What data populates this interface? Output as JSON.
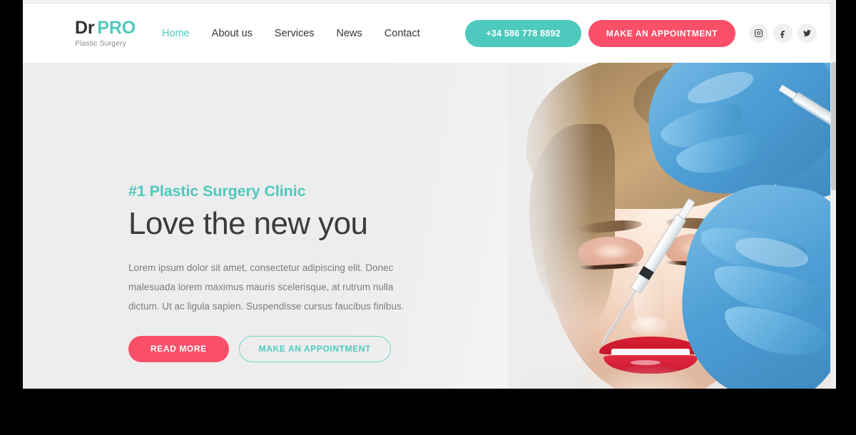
{
  "header": {
    "logo": {
      "main_dark": "Dr",
      "main_accent": "PRO",
      "tagline": "Plastic Surgery"
    },
    "nav": [
      {
        "label": "Home",
        "active": true
      },
      {
        "label": "About us",
        "active": false
      },
      {
        "label": "Services",
        "active": false
      },
      {
        "label": "News",
        "active": false
      },
      {
        "label": "Contact",
        "active": false
      }
    ],
    "phone_button": "+34 586 778 8892",
    "appointment_button": "MAKE AN APPOINTMENT",
    "social": [
      {
        "name": "instagram-icon"
      },
      {
        "name": "facebook-icon"
      },
      {
        "name": "twitter-icon"
      }
    ]
  },
  "hero": {
    "eyebrow": "#1 Plastic Surgery Clinic",
    "headline": "Love the new you",
    "paragraph": "Lorem ipsum dolor sit amet, consectetur adipiscing elit. Donec malesuada lorem maximus mauris scelerisque, at rutrum nulla dictum. Ut ac ligula sapien. Suspendisse cursus faucibus finibus.",
    "primary_button": "READ MORE",
    "secondary_button": "MAKE AN APPOINTMENT",
    "image_alt": "Woman receiving a cosmetic facial injection from gloved hands"
  },
  "colors": {
    "teal": "#4ec9bd",
    "pink": "#fa4f69",
    "dark_text": "#3a3b3f",
    "body_text": "#7c7d83",
    "hero_bg": "#eeeeee",
    "header_bg": "#ffffff",
    "social_bg": "#f0f0f1"
  }
}
